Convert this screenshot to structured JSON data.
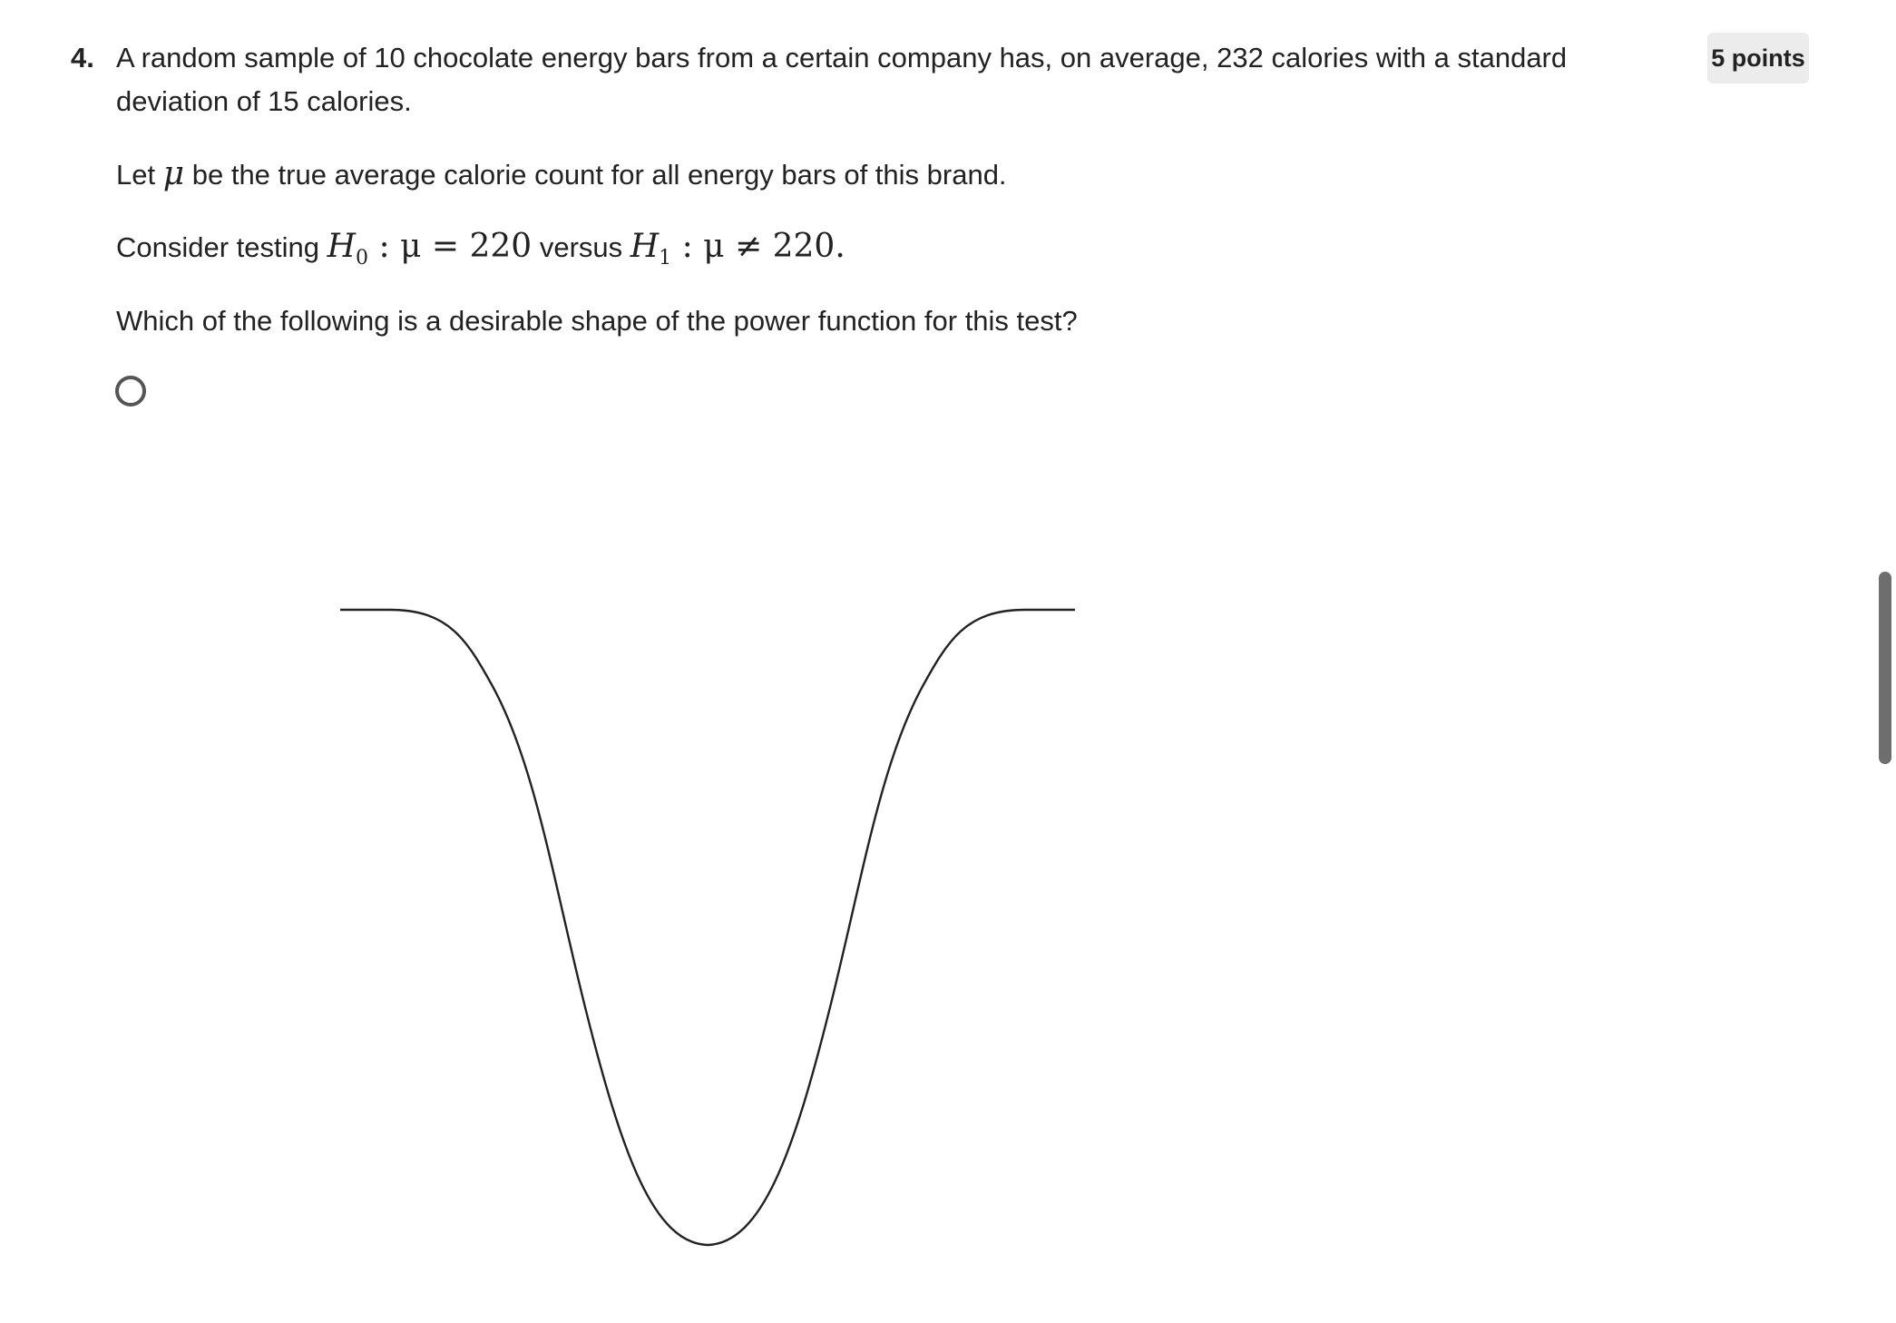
{
  "question": {
    "number": "4.",
    "line1": "A random sample of 10 chocolate energy bars from a certain company has, on average, 232 calories with a standard",
    "line2": "deviation of 15 calories.",
    "let_prefix": "Let ",
    "mu": "μ",
    "let_suffix": " be the true average calorie count for all energy bars of this brand.",
    "consider_prefix": "Consider testing ",
    "h0_letter": "H",
    "h0_sub": "0",
    "h0_rest": " : μ = 220",
    "versus": " versus ",
    "h1_letter": "H",
    "h1_sub": "1",
    "h1_rest": " : μ ≠ 220",
    "period": ".",
    "prompt": "Which of the following is a desirable shape of the power function for this test?"
  },
  "points_badge": "5 points",
  "option": {
    "image": "power-curve-dip-shape",
    "stroke_color": "#222222"
  },
  "colors": {
    "text": "#222222",
    "badge_bg": "#ececec",
    "radio_border": "#555555",
    "scroll_thumb": "#6e6e6e"
  }
}
